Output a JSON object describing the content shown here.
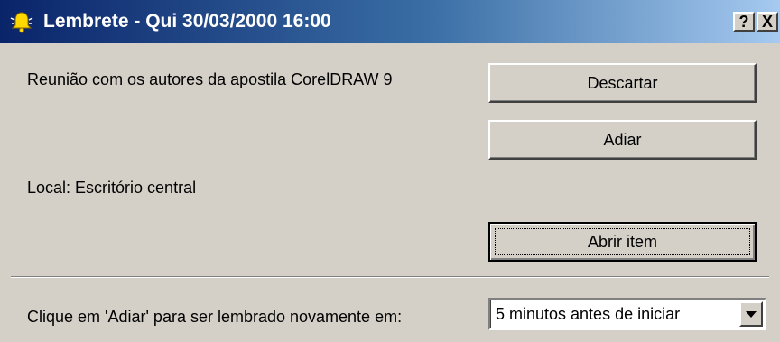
{
  "window": {
    "title": "Lembrete - Qui 30/03/2000 16:00",
    "icon": "bell-icon",
    "help_label": "?",
    "close_label": "X",
    "title_gradient": [
      "#0a246a",
      "#a6caf0"
    ]
  },
  "reminder": {
    "subject": "Reunião com os autores da apostila CorelDRAW 9",
    "location": "Local: Escritório central"
  },
  "buttons": {
    "dismiss": "Descartar",
    "snooze": "Adiar",
    "open_item": "Abrir item"
  },
  "snooze": {
    "prompt": "Clique em 'Adiar' para ser lembrado novamente em:",
    "selected": "5 minutos antes de iniciar"
  }
}
